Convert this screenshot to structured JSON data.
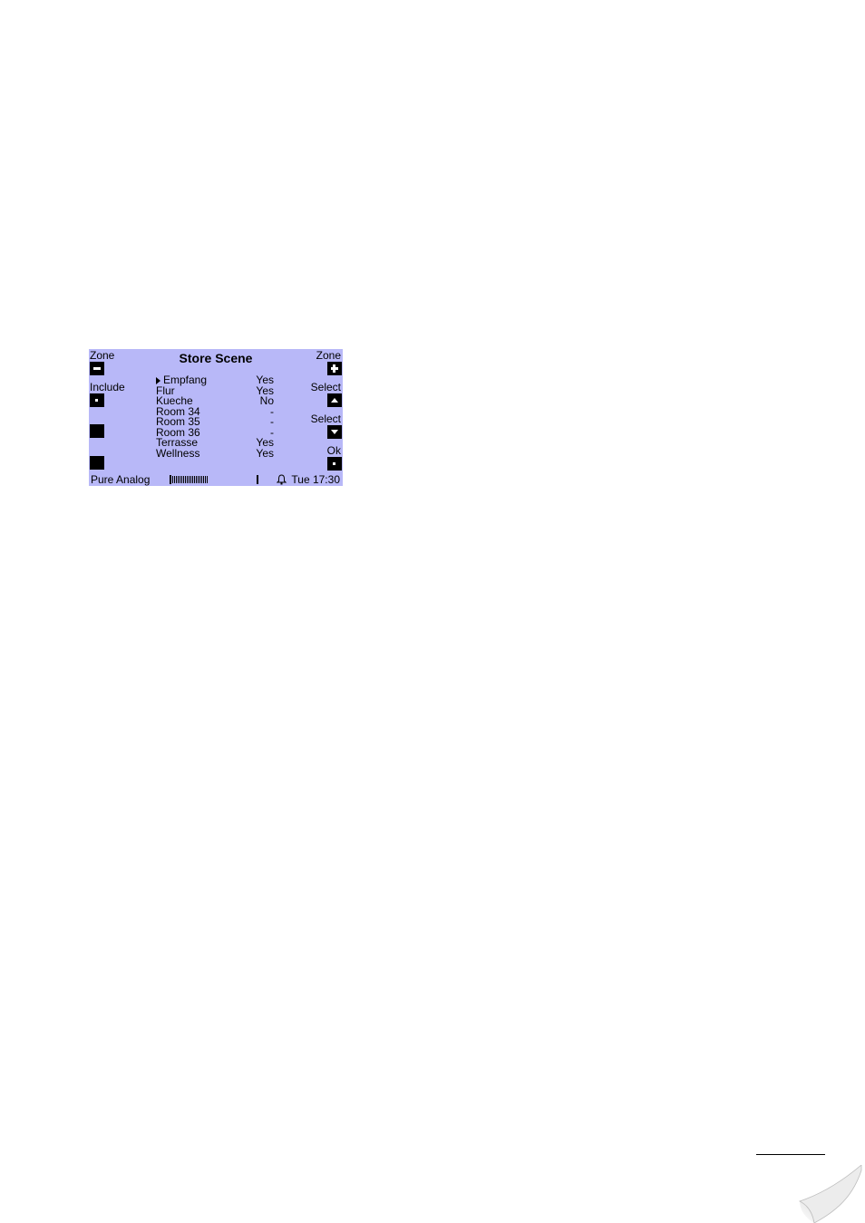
{
  "screen": {
    "title": "Store Scene",
    "left_labels": {
      "top": "Zone",
      "mid": "Include"
    },
    "right_labels": {
      "top": "Zone",
      "select_up": "Select",
      "select_down": "Select",
      "ok": "Ok"
    },
    "zones": [
      {
        "name": "Empfang",
        "value": "Yes",
        "selected": true
      },
      {
        "name": "Flur",
        "value": "Yes"
      },
      {
        "name": "Kueche",
        "value": "No"
      },
      {
        "name": "Room 34",
        "value": "-"
      },
      {
        "name": "Room 35",
        "value": "-"
      },
      {
        "name": "Room 36",
        "value": "-"
      },
      {
        "name": "Terrasse",
        "value": "Yes"
      },
      {
        "name": "Wellness",
        "value": "Yes"
      }
    ],
    "footer": {
      "source": "Pure Analog",
      "time": "Tue 17:30"
    },
    "icons": {
      "zone_prev": "minus-icon",
      "include": "dot-icon",
      "zone_next": "plus-icon",
      "select_up": "triangle-up-icon",
      "select_down": "triangle-down-icon",
      "ok": "dot-icon",
      "alarm": "bell-icon",
      "selection_marker": "triangle-right-icon"
    },
    "colors": {
      "lcd_background": "#b8b8f8",
      "text": "#000000"
    }
  }
}
